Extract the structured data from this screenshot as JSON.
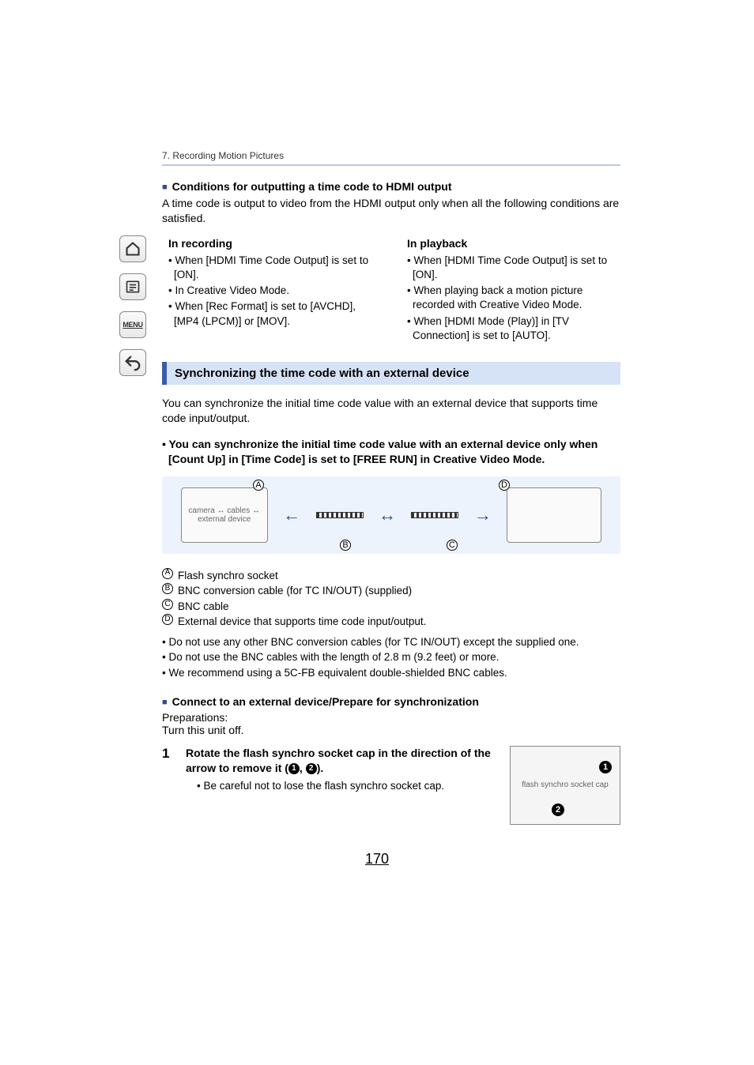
{
  "chapter": "7. Recording Motion Pictures",
  "h1": "Conditions for outputting a time code to HDMI output",
  "p1": "A time code is output to video from the HDMI output only when all the following conditions are satisfied.",
  "cols": {
    "left": {
      "head": "In recording",
      "items": [
        "When [HDMI Time Code Output] is set to [ON].",
        "In Creative Video Mode.",
        "When [Rec Format] is set to [AVCHD], [MP4 (LPCM)] or [MOV]."
      ]
    },
    "right": {
      "head": "In playback",
      "items": [
        "When [HDMI Time Code Output] is set to [ON].",
        "When playing back a motion picture recorded with Creative Video Mode.",
        "When [HDMI Mode (Play)] in [TV Connection] is set to [AUTO]."
      ]
    }
  },
  "section_bar": "Synchronizing the time code with an external device",
  "p2": "You can synchronize the initial time code value with an external device that supports time code input/output.",
  "note_bold": "You can synchronize the initial time code value with an external device only when [Count Up] in [Time Code] is set to [FREE RUN] in Creative Video Mode.",
  "legend": {
    "A": "Flash synchro socket",
    "B": "BNC conversion cable (for TC IN/OUT) (supplied)",
    "C": "BNC cable",
    "D": "External device that supports time code input/output."
  },
  "notes2": [
    "Do not use any other BNC conversion cables (for TC IN/OUT) except the supplied one.",
    "Do not use the BNC cables with the length of 2.8 m (9.2 feet) or more.",
    "We recommend using a 5C-FB equivalent double-shielded BNC cables."
  ],
  "h2": "Connect to an external device/Prepare for synchronization",
  "prep1": "Preparations:",
  "prep2": "Turn this unit off.",
  "step": {
    "num": "1",
    "main_a": "Rotate the flash synchro socket cap in the direction of the arrow to remove it (",
    "main_b": ", ",
    "main_c": ").",
    "sub": "Be careful not to lose the flash synchro socket cap."
  },
  "page": "170",
  "nav": {
    "menu_label": "MENU"
  },
  "alt": {
    "diagram": "camera ↔ cables ↔ external device",
    "step_img": "flash synchro socket cap"
  }
}
